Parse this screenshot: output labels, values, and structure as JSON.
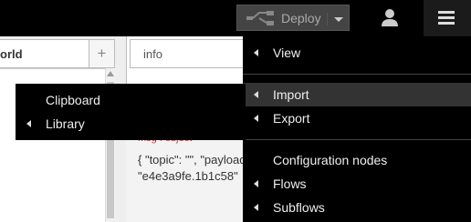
{
  "header": {
    "deploy_label": "Deploy"
  },
  "workspace": {
    "flow_tab_label": "orld",
    "add_flow_label": "+"
  },
  "sidebar": {
    "tab_label": "info",
    "debug": {
      "meta": "msg . object",
      "line1": "{ \"topic\": \"\", \"payload\":",
      "line2": "\"e4e3a9fe.1b1c58\""
    }
  },
  "main_menu": {
    "items": [
      {
        "label": "View"
      },
      {
        "label": "Import"
      },
      {
        "label": "Export"
      },
      {
        "label": "Configuration nodes"
      },
      {
        "label": "Flows"
      },
      {
        "label": "Subflows"
      }
    ]
  },
  "import_submenu": {
    "items": [
      {
        "label": "Clipboard"
      },
      {
        "label": "Library"
      }
    ]
  }
}
